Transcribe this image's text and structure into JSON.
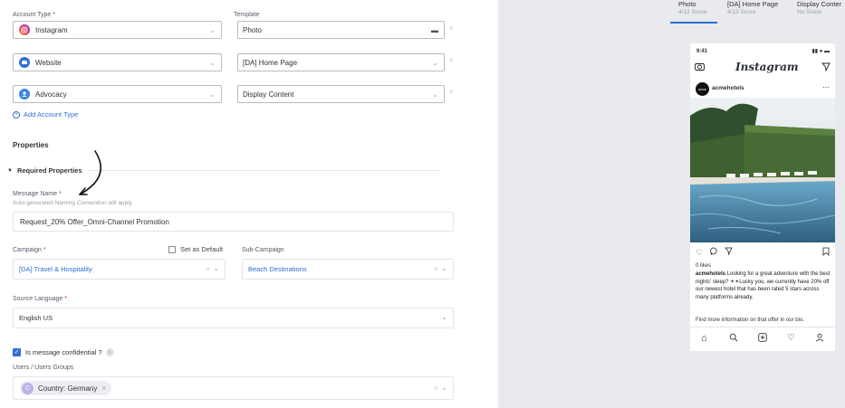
{
  "form": {
    "account_type_label": "Account Type",
    "template_label": "Template",
    "rows": [
      {
        "account": "Instagram",
        "template": "Photo"
      },
      {
        "account": "Website",
        "template": "[DA] Home Page"
      },
      {
        "account": "Advocacy",
        "template": "Display Content"
      }
    ],
    "add_account_type": "Add Account Type",
    "properties_heading": "Properties",
    "required_properties": "Required Properties",
    "message_name_label": "Message Name",
    "message_name_hint": "Auto-generated Naming Convention will apply",
    "message_name_value": "Request_20% Offer_Omni-Channel Promotion",
    "campaign_label": "Campaign",
    "set_as_default": "Set as Default",
    "sub_campaign_label": "Sub-Campaign",
    "campaign_value": "[DA] Travel & Hospitality",
    "sub_campaign_value": "Beach Destinations",
    "source_language_label": "Source Language",
    "source_language_value": "English US",
    "confidential_label": "Is message confidential ?",
    "users_label": "Users / Users Groups",
    "users_chip": "Country: Germany",
    "users_chip_avatar": "C"
  },
  "preview": {
    "tabs": [
      {
        "title": "Photo",
        "score": "4/13 Score"
      },
      {
        "title": "[DA] Home Page",
        "score": "4/13 Score"
      },
      {
        "title": "Display Conter",
        "score": "No Score"
      }
    ],
    "phone": {
      "time": "9:41",
      "app_name": "Instagram",
      "avatar_text": "acme",
      "username": "acmehotels",
      "likes": "0 likes",
      "caption_user": "acmehotels",
      "caption": "Looking for a great adventure with the best nights' sleep? ✴✴Lucky you, we currently have 20% off our newest hotel that has been rated 5 stars across many platforms already.",
      "caption_more": "Find more information on that offer in our bio."
    }
  },
  "colors": {
    "accent": "#2f6fd6",
    "required": "#c0392b",
    "panel_bg": "#e9eaee"
  }
}
